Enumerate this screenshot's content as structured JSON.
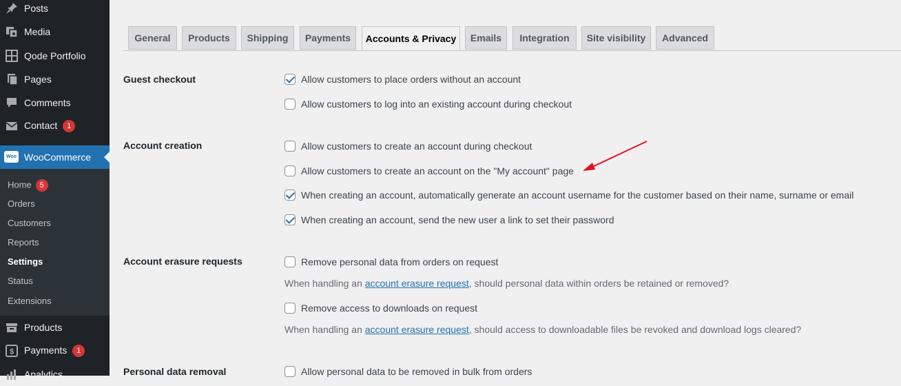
{
  "sidebar": {
    "items": [
      {
        "label": "Posts",
        "icon": "pin-icon"
      },
      {
        "label": "Media",
        "icon": "media-icon"
      },
      {
        "label": "Qode Portfolio",
        "icon": "grid-icon"
      },
      {
        "label": "Pages",
        "icon": "pages-icon"
      },
      {
        "label": "Comments",
        "icon": "comment-icon"
      },
      {
        "label": "Contact",
        "icon": "mail-icon",
        "badge": "1"
      }
    ],
    "woocommerce": {
      "label": "WooCommerce",
      "icon_text": "Woo"
    },
    "submenu": [
      {
        "label": "Home",
        "badge": "5"
      },
      {
        "label": "Orders"
      },
      {
        "label": "Customers"
      },
      {
        "label": "Reports"
      },
      {
        "label": "Settings"
      },
      {
        "label": "Status"
      },
      {
        "label": "Extensions"
      }
    ],
    "after": [
      {
        "label": "Products",
        "icon": "products-icon"
      },
      {
        "label": "Payments",
        "icon": "payments-icon",
        "badge": "1"
      },
      {
        "label": "Analytics",
        "icon": "analytics-icon"
      }
    ]
  },
  "tabs": [
    "General",
    "Products",
    "Shipping",
    "Payments",
    "Accounts & Privacy",
    "Emails",
    "Integration",
    "Site visibility",
    "Advanced"
  ],
  "active_tab": "Accounts & Privacy",
  "sections": {
    "guest": {
      "label": "Guest checkout",
      "opt1": "Allow customers to place orders without an account",
      "opt2": "Allow customers to log into an existing account during checkout"
    },
    "creation": {
      "label": "Account creation",
      "opt1": "Allow customers to create an account during checkout",
      "opt2": "Allow customers to create an account on the \"My account\" page",
      "opt3": "When creating an account, automatically generate an account username for the customer based on their name, surname or email",
      "opt4": "When creating an account, send the new user a link to set their password"
    },
    "erasure": {
      "label": "Account erasure requests",
      "opt1": "Remove personal data from orders on request",
      "desc1_pre": "When handling an ",
      "desc1_link": "account erasure request",
      "desc1_post": ", should personal data within orders be retained or removed?",
      "opt2": "Remove access to downloads on request",
      "desc2_pre": "When handling an ",
      "desc2_link": "account erasure request",
      "desc2_post": ", should access to downloadable files be revoked and download logs cleared?"
    },
    "removal": {
      "label": "Personal data removal",
      "opt1": "Allow personal data to be removed in bulk from orders"
    }
  },
  "checkbox_states": {
    "guest_opt1": true,
    "guest_opt2": false,
    "creation_opt1": false,
    "creation_opt2": false,
    "creation_opt3": true,
    "creation_opt4": true,
    "erasure_opt1": false,
    "erasure_opt2": false,
    "removal_opt1": false
  },
  "colors": {
    "sidebar": "#1d2327",
    "accent": "#2271b1",
    "badge": "#d63638",
    "annotation_arrow": "#e3101b"
  }
}
